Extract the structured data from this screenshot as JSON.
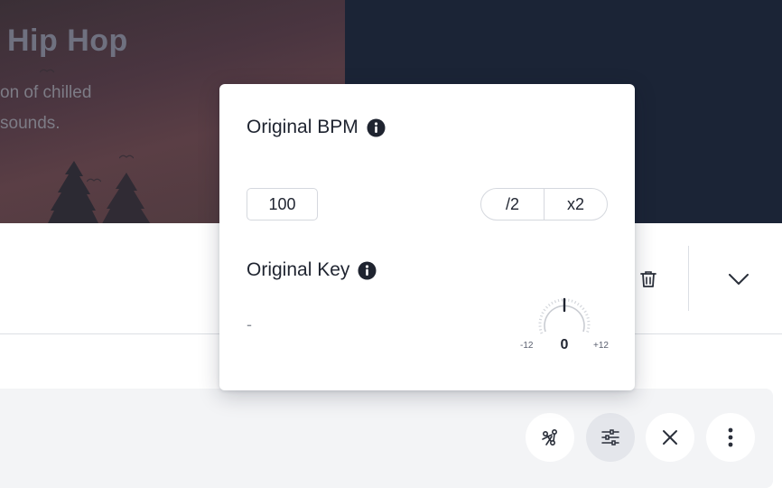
{
  "hero": {
    "title": "Hip Hop",
    "description_line1": "on of chilled",
    "description_line2": "sounds."
  },
  "popover": {
    "bpm_title": "Original BPM",
    "bpm_value": "100",
    "half_label": "/2",
    "double_label": "x2",
    "key_title": "Original Key",
    "key_value": "-",
    "knob_min": "-12",
    "knob_max": "+12",
    "knob_value": "0"
  },
  "icons": {
    "info": "info-icon",
    "trash": "trash-icon",
    "chevron": "chevron-down-icon",
    "stems": "stems-icon",
    "settings": "sliders-icon",
    "close": "close-icon",
    "more": "more-vertical-icon"
  },
  "colors": {
    "hero_bg": "#1b2436",
    "popover_bg": "#ffffff",
    "text": "#1f2430",
    "active_button": "#e4e6eb",
    "player_bar": "#f3f4f6"
  }
}
